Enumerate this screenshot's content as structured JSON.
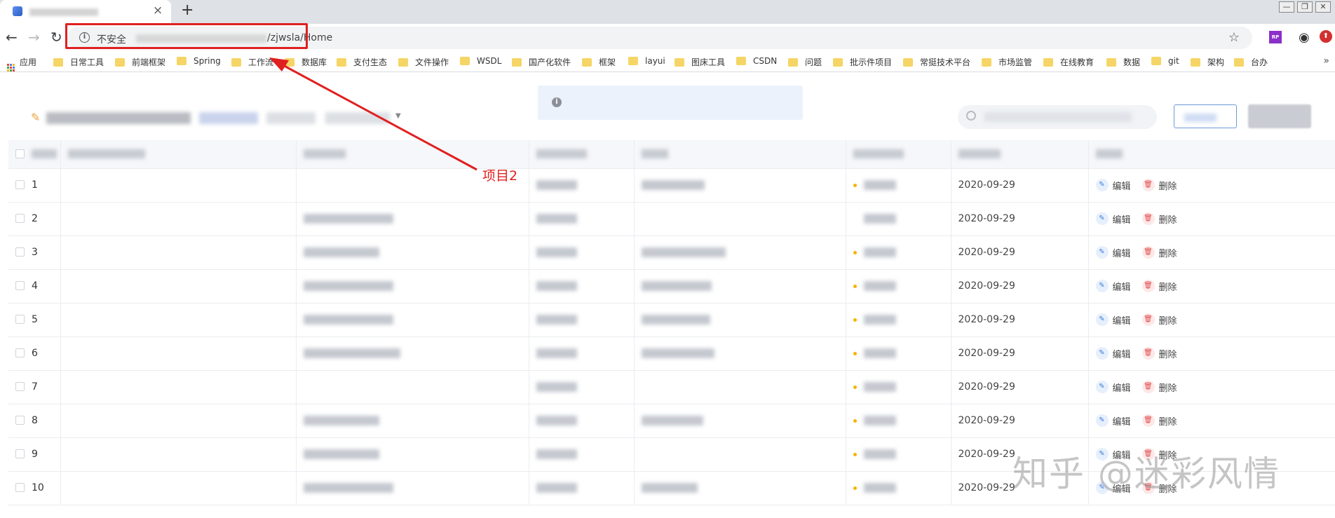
{
  "browser": {
    "new_tab": "+",
    "address_insecure": "不安全",
    "address_path": "/zjwsla/Home",
    "bookmarks": [
      "应用",
      "日常工具",
      "前端框架",
      "Spring",
      "工作流",
      "数据库",
      "支付生态",
      "文件操作",
      "WSDL",
      "国产化软件",
      "框架",
      "layui",
      "图床工具",
      "CSDN",
      "问题",
      "批示件项目",
      "常挺技术平台",
      "市场监管",
      "在线教育",
      "数据",
      "git",
      "架构",
      "台办"
    ]
  },
  "table": {
    "rows": [
      {
        "no": "1",
        "date": "2020-09-29"
      },
      {
        "no": "2",
        "date": "2020-09-29"
      },
      {
        "no": "3",
        "date": "2020-09-29"
      },
      {
        "no": "4",
        "date": "2020-09-29"
      },
      {
        "no": "5",
        "date": "2020-09-29"
      },
      {
        "no": "6",
        "date": "2020-09-29"
      },
      {
        "no": "7",
        "date": "2020-09-29"
      },
      {
        "no": "8",
        "date": "2020-09-29"
      },
      {
        "no": "9",
        "date": "2020-09-29"
      },
      {
        "no": "10",
        "date": "2020-09-29"
      }
    ],
    "edit_label": "编辑",
    "delete_label": "删除"
  },
  "annotation": {
    "label": "项目2",
    "color": "#e02020"
  },
  "watermark": "知乎 @迷彩风情"
}
